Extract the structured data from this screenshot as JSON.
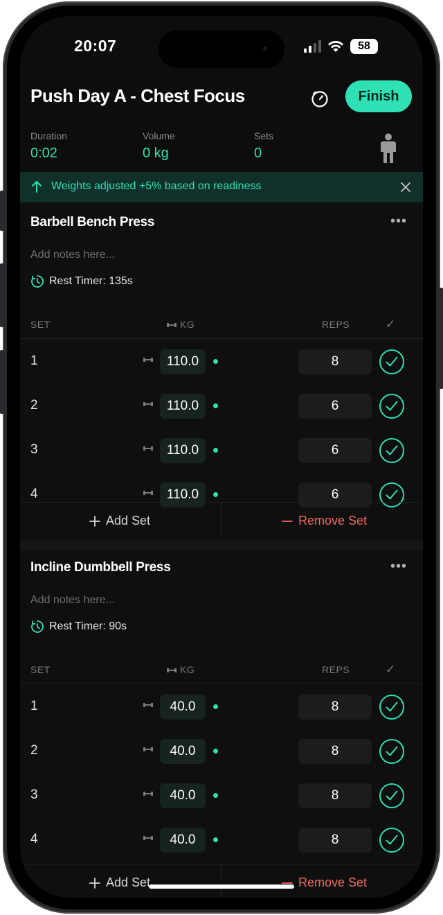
{
  "status": {
    "time": "20:07",
    "battery": "58"
  },
  "header": {
    "title": "Push Day A - Chest Focus",
    "finish_label": "Finish"
  },
  "stats": {
    "duration_label": "Duration",
    "duration": "0:02",
    "volume_label": "Volume",
    "volume": "0 kg",
    "sets_label": "Sets",
    "sets": "0"
  },
  "banner": {
    "text": "Weights adjusted +5% based on readiness"
  },
  "columns": {
    "set": "SET",
    "kg": "KG",
    "reps": "REPS",
    "done": "✓"
  },
  "actions": {
    "add_set": "Add Set",
    "remove_set": "Remove Set"
  },
  "exercises": [
    {
      "name": "Barbell Bench Press",
      "notes_placeholder": "Add notes here...",
      "rest_timer": "Rest Timer: 135s",
      "sets": [
        {
          "set": "1",
          "kg": "110.0",
          "reps": "8"
        },
        {
          "set": "2",
          "kg": "110.0",
          "reps": "6"
        },
        {
          "set": "3",
          "kg": "110.0",
          "reps": "6"
        },
        {
          "set": "4",
          "kg": "110.0",
          "reps": "6"
        }
      ]
    },
    {
      "name": "Incline Dumbbell Press",
      "notes_placeholder": "Add notes here...",
      "rest_timer": "Rest Timer: 90s",
      "sets": [
        {
          "set": "1",
          "kg": "40.0",
          "reps": "8"
        },
        {
          "set": "2",
          "kg": "40.0",
          "reps": "8"
        },
        {
          "set": "3",
          "kg": "40.0",
          "reps": "8"
        },
        {
          "set": "4",
          "kg": "40.0",
          "reps": "8"
        }
      ]
    }
  ],
  "colors": {
    "accent": "#2ee0b4",
    "danger": "#f06a5d",
    "background": "#0d0d0d"
  }
}
